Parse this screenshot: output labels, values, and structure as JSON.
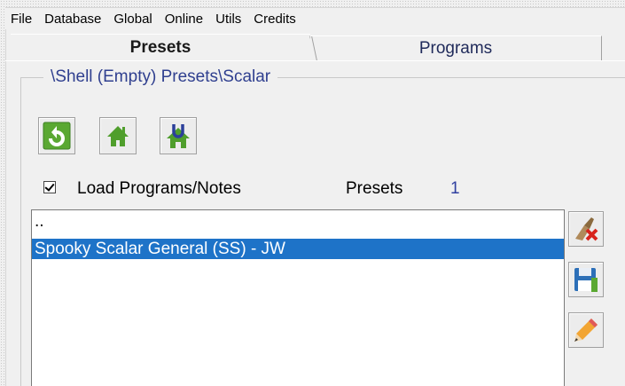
{
  "menu": {
    "items": [
      "File",
      "Database",
      "Global",
      "Online",
      "Utils",
      "Credits"
    ]
  },
  "tabs": [
    {
      "label": "Presets",
      "active": true
    },
    {
      "label": "Programs",
      "active": false
    }
  ],
  "path": "\\Shell (Empty) Presets\\Scalar",
  "toolbar": {
    "icons": [
      "refresh-up-icon",
      "home-icon",
      "up-home-icon"
    ]
  },
  "options": {
    "load_programs_label": "Load Programs/Notes",
    "load_programs_checked": true,
    "presets_label": "Presets",
    "presets_count": "1"
  },
  "list": {
    "items": [
      {
        "label": "..",
        "selected": false
      },
      {
        "label": "Spooky Scalar General (SS) - JW",
        "selected": true
      }
    ]
  },
  "side_buttons": {
    "icons": [
      "delete-icon",
      "save-icon",
      "edit-icon"
    ]
  },
  "colors": {
    "selection": "#1e73c8",
    "path_text": "#2f3f8f",
    "icon_green": "#5aa832"
  }
}
